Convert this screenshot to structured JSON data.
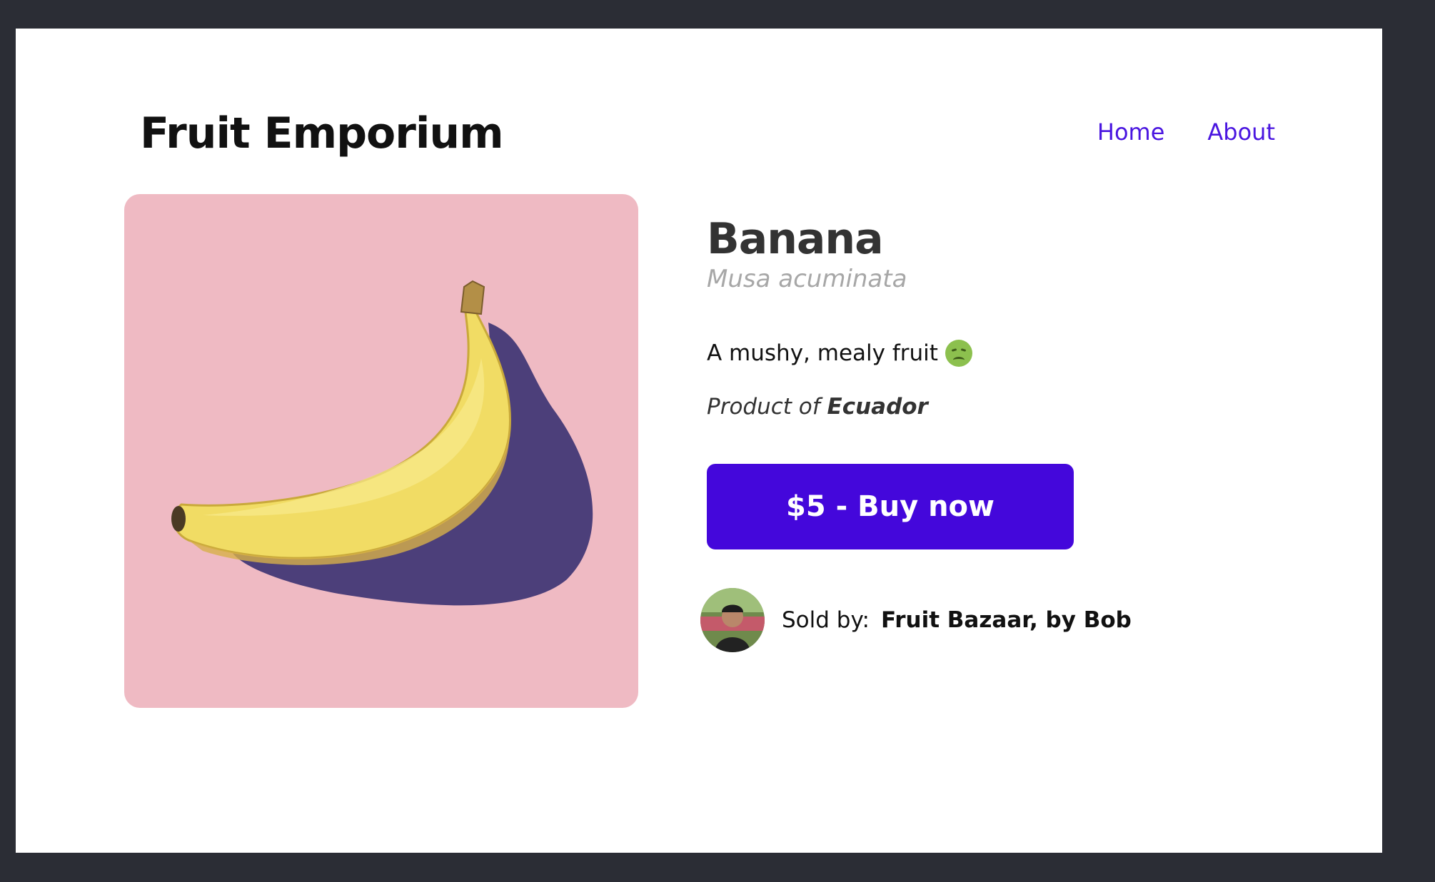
{
  "header": {
    "title": "Fruit Emporium",
    "nav": [
      {
        "label": "Home"
      },
      {
        "label": "About"
      }
    ]
  },
  "product": {
    "name": "Banana",
    "scientific_name": "Musa acuminata",
    "description": "A mushy, mealy fruit",
    "description_emoji": "nauseated-face-icon",
    "origin_prefix": "Product of",
    "origin_country": "Ecuador",
    "buy_label": "$5 - Buy now",
    "image_background": "#efbac3"
  },
  "seller": {
    "label": "Sold by:",
    "name": "Fruit Bazaar, by Bob"
  },
  "colors": {
    "accent": "#4407db",
    "nav_link": "#4a16e0",
    "page_background": "#2b2d35"
  }
}
